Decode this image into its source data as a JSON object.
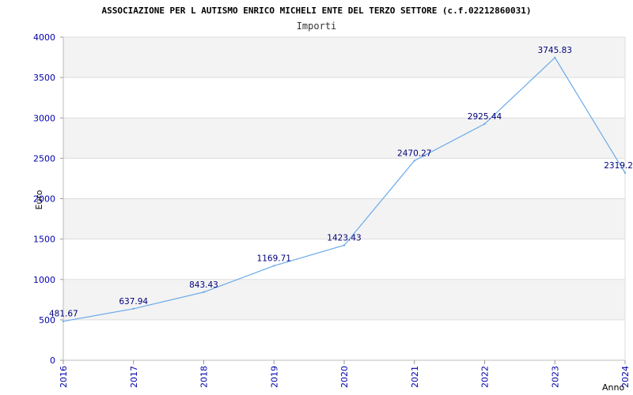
{
  "chart_data": {
    "type": "line",
    "title": "ASSOCIAZIONE PER L AUTISMO ENRICO MICHELI ENTE DEL TERZO SETTORE (c.f.02212860031)",
    "subtitle": "Importi",
    "xlabel": "Anno",
    "ylabel": "Euro",
    "x": [
      "2016",
      "2017",
      "2018",
      "2019",
      "2020",
      "2021",
      "2022",
      "2023",
      "2024"
    ],
    "values": [
      481.67,
      637.94,
      843.43,
      1169.71,
      1423.43,
      2470.27,
      2925.44,
      3745.83,
      2319.2
    ],
    "data_labels": [
      "481.67",
      "637.94",
      "843.43",
      "1169.71",
      "1423.43",
      "2470.27",
      "2925.44",
      "3745.83",
      "2319.2"
    ],
    "ylim": [
      0,
      4000
    ],
    "yticks": [
      "0",
      "500",
      "1000",
      "1500",
      "2000",
      "2500",
      "3000",
      "3500",
      "4000"
    ],
    "grid": true,
    "line_color": "#6aaae8",
    "band_color": "#f3f3f3"
  }
}
